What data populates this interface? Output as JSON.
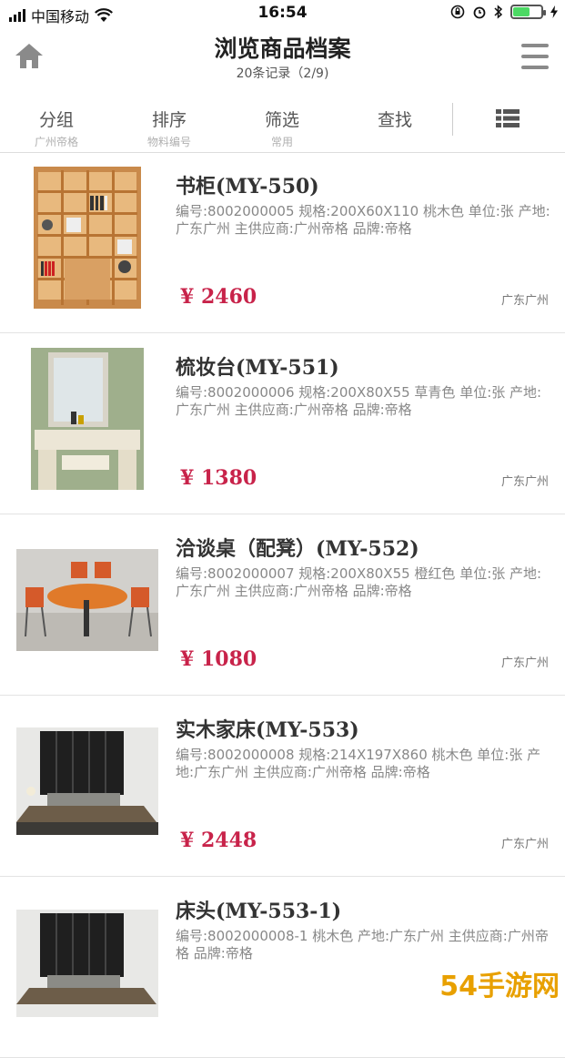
{
  "status": {
    "carrier": "中国移动",
    "time": "16:54"
  },
  "header": {
    "title": "浏览商品档案",
    "subtitle": "20条记录（2/9)"
  },
  "toolbar": {
    "tabs": [
      {
        "label": "分组",
        "hint": "广州帝格"
      },
      {
        "label": "排序",
        "hint": "物料编号"
      },
      {
        "label": "筛选",
        "hint": "常用"
      },
      {
        "label": "查找",
        "hint": ""
      }
    ]
  },
  "products": [
    {
      "name": "书柜(MY-550)",
      "desc": "编号:8002000005 规格:200X60X110 桃木色 单位:张 产地:广东广州 主供应商:广州帝格 品牌:帝格",
      "price": "¥ 2460",
      "location": "广东广州",
      "image": "bookshelf"
    },
    {
      "name": "梳妆台(MY-551)",
      "desc": "编号:8002000006 规格:200X80X55 草青色 单位:张 产地:广东广州 主供应商:广州帝格 品牌:帝格",
      "price": "¥ 1380",
      "location": "广东广州",
      "image": "dresser"
    },
    {
      "name": "洽谈桌（配凳）(MY-552)",
      "desc": "编号:8002000007 规格:200X80X55 橙红色 单位:张 产地:广东广州 主供应商:广州帝格 品牌:帝格",
      "price": "¥ 1080",
      "location": "广东广州",
      "image": "table"
    },
    {
      "name": "实木家床(MY-553)",
      "desc": "编号:8002000008 规格:214X197X860 桃木色 单位:张 产地:广东广州 主供应商:广州帝格 品牌:帝格",
      "price": "¥ 2448",
      "location": "广东广州",
      "image": "bed"
    },
    {
      "name": "床头(MY-553-1)",
      "desc": "编号:8002000008-1 桃木色 产地:广东广州 主供应商:广州帝格 品牌:帝格",
      "price": "",
      "location": "",
      "image": "bed"
    }
  ],
  "watermark": "54手游网"
}
